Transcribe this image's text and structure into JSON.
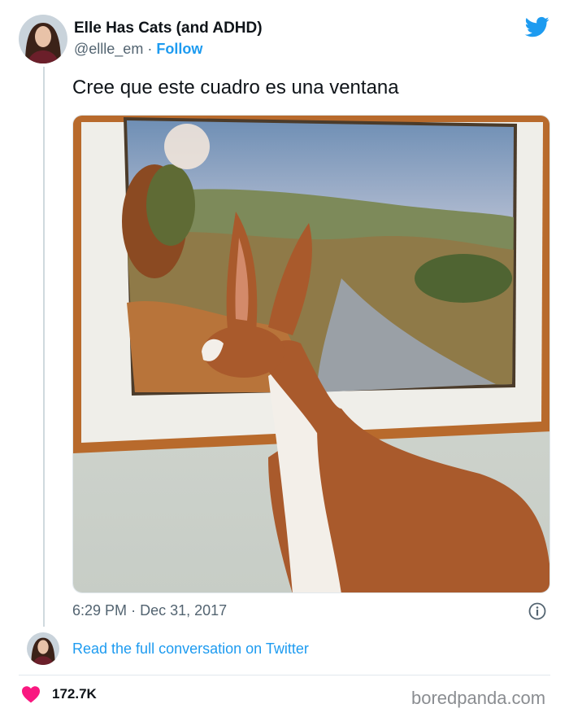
{
  "tweet": {
    "author_name": "Elle Has Cats (and ADHD)",
    "handle": "@ellle_em",
    "separator": "·",
    "follow_label": "Follow",
    "text": "Cree que este cuadro es una ventana",
    "time": "6:29 PM",
    "date": "Dec 31, 2017",
    "read_conversation": "Read the full conversation on Twitter",
    "likes": "172.7K"
  },
  "watermark": "boredpanda.com",
  "icons": {
    "brand": "twitter-bird-icon",
    "info": "info-icon",
    "like": "heart-icon"
  },
  "colors": {
    "accent": "#1d9bf0",
    "heart": "#f91880",
    "secondary_text": "#536471"
  }
}
